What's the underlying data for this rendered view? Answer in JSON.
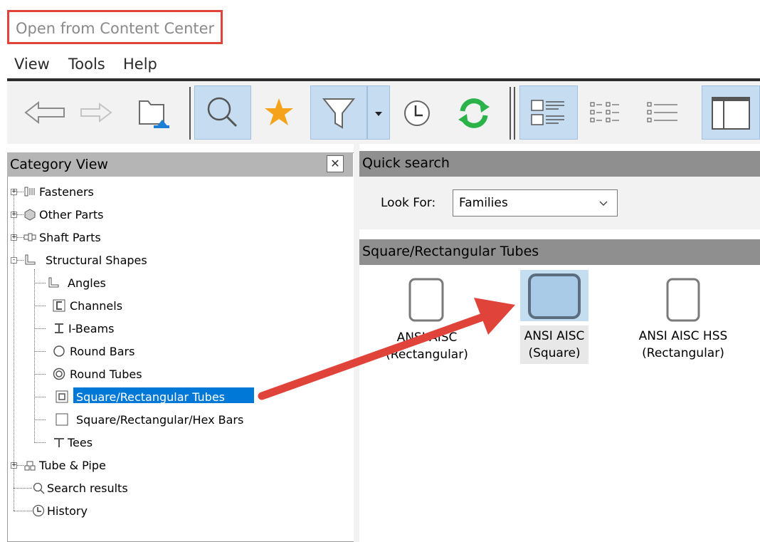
{
  "window": {
    "title": "Open from Content Center"
  },
  "menu": {
    "items": [
      "View",
      "Tools",
      "Help"
    ]
  },
  "toolbar": {
    "buttons": [
      "back-arrow-icon",
      "forward-arrow-icon",
      "folder-up-icon",
      "search-icon",
      "favorites-star-icon",
      "filter-icon",
      "filter-dropdown-icon",
      "history-clock-icon",
      "refresh-icon",
      "detail-view-icon",
      "list-view-icon",
      "small-icons-view-icon",
      "panel-layout-icon"
    ],
    "colors": {
      "star": "#f5a31a",
      "refresh": "#2bb34a",
      "selected": "#c6dcf0"
    }
  },
  "category_view": {
    "title": "Category View",
    "close_label": "✕",
    "tree": [
      {
        "label": "Fasteners",
        "expander": "+"
      },
      {
        "label": "Other Parts",
        "expander": "+"
      },
      {
        "label": "Shaft Parts",
        "expander": "+"
      },
      {
        "label": "Structural Shapes",
        "expander": "-"
      },
      {
        "label": "Angles"
      },
      {
        "label": "Channels"
      },
      {
        "label": "I-Beams"
      },
      {
        "label": "Round Bars"
      },
      {
        "label": "Round Tubes"
      },
      {
        "label": "Square/Rectangular Tubes",
        "selected": true
      },
      {
        "label": "Square/Rectangular/Hex Bars"
      },
      {
        "label": "Tees"
      },
      {
        "label": "Tube & Pipe",
        "expander": "+"
      },
      {
        "label": "Search results"
      },
      {
        "label": "History"
      }
    ]
  },
  "quick_search": {
    "title": "Quick search",
    "look_for_label": "Look For:",
    "look_for_value": "Families"
  },
  "results": {
    "title": "Square/Rectangular Tubes",
    "items": [
      {
        "line1": "ANSI AISC",
        "line2": "(Rectangular)"
      },
      {
        "line1": "ANSI AISC",
        "line2": "(Square)",
        "selected": true
      },
      {
        "line1": "ANSI AISC HSS",
        "line2": "(Rectangular)"
      }
    ]
  },
  "annotation": {
    "arrow_color": "#e0433a"
  }
}
